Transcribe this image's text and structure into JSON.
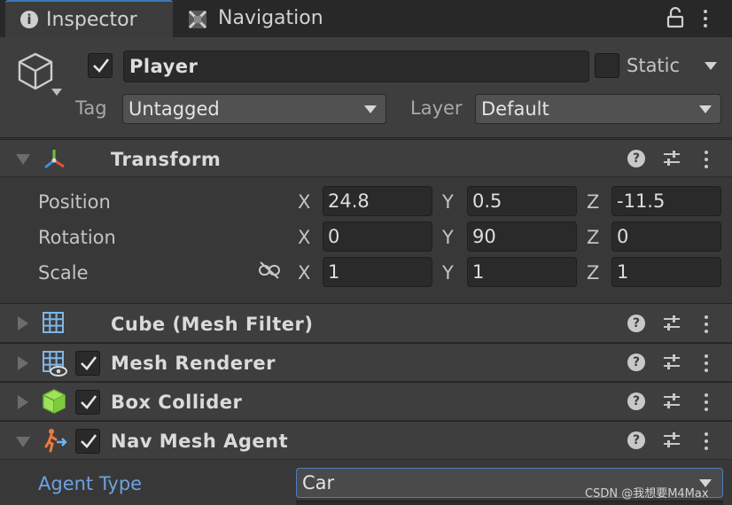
{
  "tabs": [
    {
      "label": "Inspector",
      "active": true,
      "icon": "info-icon"
    },
    {
      "label": "Navigation",
      "active": false,
      "icon": "navigation-icon"
    }
  ],
  "object": {
    "active": true,
    "name": "Player",
    "static_label": "Static",
    "static_checked": false,
    "tag_label": "Tag",
    "tag_value": "Untagged",
    "layer_label": "Layer",
    "layer_value": "Default"
  },
  "transform": {
    "title": "Transform",
    "rows": [
      {
        "label": "Position",
        "x": "24.8",
        "y": "0.5",
        "z": "-11.5"
      },
      {
        "label": "Rotation",
        "x": "0",
        "y": "90",
        "z": "0"
      },
      {
        "label": "Scale",
        "x": "1",
        "y": "1",
        "z": "1"
      }
    ],
    "axis": {
      "x": "X",
      "y": "Y",
      "z": "Z"
    }
  },
  "components": [
    {
      "title": "Cube (Mesh Filter)",
      "has_checkbox": false,
      "expanded": false,
      "icon": "mesh-filter-icon"
    },
    {
      "title": "Mesh Renderer",
      "has_checkbox": true,
      "expanded": false,
      "icon": "mesh-renderer-icon"
    },
    {
      "title": "Box Collider",
      "has_checkbox": true,
      "expanded": false,
      "icon": "box-collider-icon"
    },
    {
      "title": "Nav Mesh Agent",
      "has_checkbox": true,
      "expanded": true,
      "icon": "nav-mesh-agent-icon"
    }
  ],
  "nav_agent": {
    "agent_type_label": "Agent Type",
    "agent_type_value": "Car"
  },
  "watermark": "CSDN @我想要M4Max",
  "colors": {
    "accent": "#3a79bb",
    "link_label": "#6ea1e0",
    "panel": "#383838",
    "header": "#3e3e3e",
    "field": "#2a2a2a"
  }
}
